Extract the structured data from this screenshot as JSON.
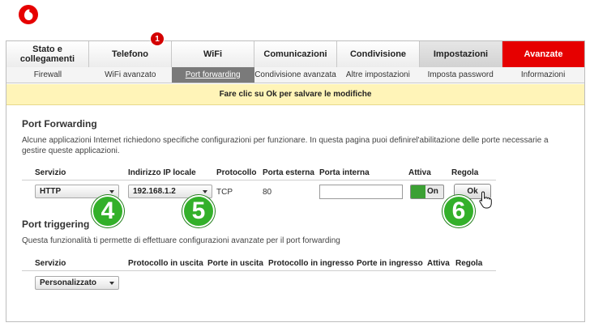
{
  "brand": {
    "logo_color": "#e60000",
    "icon": "vodafone-logo-icon"
  },
  "main_tabs": [
    {
      "label": "Stato e collegamenti",
      "state": "normal"
    },
    {
      "label": "Telefono",
      "state": "normal"
    },
    {
      "label": "WiFi",
      "state": "normal"
    },
    {
      "label": "Comunicazioni",
      "state": "normal"
    },
    {
      "label": "Condivisione",
      "state": "normal"
    },
    {
      "label": "Impostazioni",
      "state": "selected"
    },
    {
      "label": "Avanzate",
      "state": "red"
    }
  ],
  "telefono_badge": "1",
  "sub_tabs": [
    {
      "label": "Firewall",
      "active": false
    },
    {
      "label": "WiFi avanzato",
      "active": false
    },
    {
      "label": "Port forwarding",
      "active": true
    },
    {
      "label": "Condivisione avanzata",
      "active": false
    },
    {
      "label": "Altre impostazioni",
      "active": false
    },
    {
      "label": "Imposta password",
      "active": false
    },
    {
      "label": "Informazioni",
      "active": false
    }
  ],
  "notice": "Fare clic su Ok per salvare le modifiche",
  "port_forwarding": {
    "title": "Port Forwarding",
    "description": "Alcune applicazioni Internet richiedono specifiche configurazioni per funzionare. In questa pagina puoi definirel'abilitazione delle porte necessarie a gestire queste applicazioni.",
    "headers": {
      "servizio": "Servizio",
      "ip": "Indirizzo IP locale",
      "protocollo": "Protocollo",
      "porta_esterna": "Porta esterna",
      "porta_interna": "Porta interna",
      "attiva": "Attiva",
      "regola": "Regola"
    },
    "row": {
      "servizio": "HTTP",
      "ip": "192.168.1.2",
      "protocollo": "TCP",
      "porta_esterna": "80",
      "porta_interna_value": "",
      "attiva_label": "On",
      "ok_label": "Ok"
    }
  },
  "port_triggering": {
    "title": "Port triggering",
    "description": "Questa funzionalità ti permette di effettuare configurazioni avanzate per il port forwarding",
    "headers": {
      "servizio": "Servizio",
      "proto_uscita": "Protocollo in uscita",
      "porte_uscita": "Porte in uscita",
      "proto_ingresso": "Protocollo in ingresso",
      "porte_ingresso": "Porte in ingresso",
      "attiva": "Attiva",
      "regola": "Regola"
    },
    "servizio_value": "Personalizzato"
  },
  "steps": [
    "4",
    "5",
    "6"
  ],
  "colors": {
    "accent_red": "#e60000",
    "step_green": "#33b02a",
    "toggle_green": "#3ca034",
    "notice_bg": "#fff4b8"
  }
}
